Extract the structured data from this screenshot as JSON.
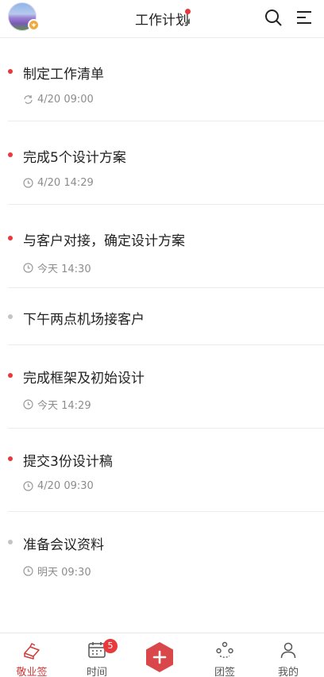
{
  "header": {
    "title": "工作计划",
    "icons": {
      "avatar": "avatar-image",
      "search": "search-icon",
      "menu": "menu-icon"
    },
    "accent_color": "#e8393d"
  },
  "tasks": [
    {
      "title": "制定工作清单",
      "time": "4/20 09:00",
      "dot": "red",
      "time_icon": "repeat-icon"
    },
    {
      "title": "完成5个设计方案",
      "time": "4/20 14:29",
      "dot": "red",
      "time_icon": "clock-icon"
    },
    {
      "title": "与客户对接，确定设计方案",
      "time": "今天 14:30",
      "dot": "red",
      "time_icon": "clock-icon"
    },
    {
      "title": "下午两点机场接客户",
      "time": "",
      "dot": "gray",
      "time_icon": ""
    },
    {
      "title": "完成框架及初始设计",
      "time": "今天 14:29",
      "dot": "red",
      "time_icon": "clock-icon"
    },
    {
      "title": "提交3份设计稿",
      "time": "4/20 09:30",
      "dot": "red",
      "time_icon": "clock-icon"
    },
    {
      "title": "准备会议资料",
      "time": "明天 09:30",
      "dot": "gray",
      "time_icon": "clock-icon"
    }
  ],
  "nav": {
    "items": [
      {
        "label": "敬业签",
        "icon": "notebook-icon",
        "active": true
      },
      {
        "label": "时间",
        "icon": "calendar-icon",
        "badge": "5"
      },
      {
        "label": "",
        "icon": "add-icon"
      },
      {
        "label": "团签",
        "icon": "team-icon"
      },
      {
        "label": "我的",
        "icon": "user-icon"
      }
    ]
  },
  "colors": {
    "active": "#d23c3c",
    "dot_red": "#e8393d",
    "dot_gray": "#c4c4c4",
    "fab": "#d9474a"
  }
}
